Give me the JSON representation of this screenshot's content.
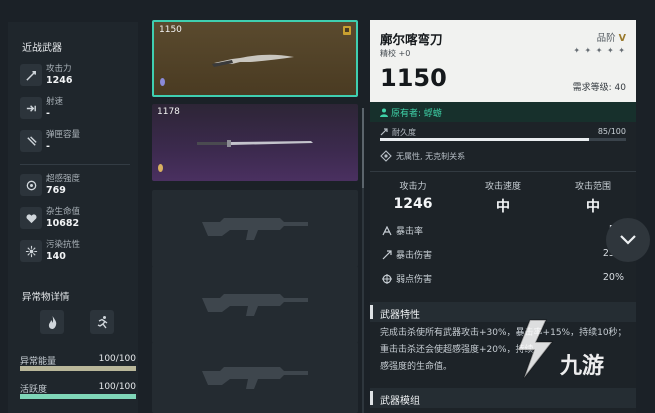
{
  "left_panel": {
    "category": "近战武器",
    "stats": [
      {
        "icon": "attack-icon",
        "label": "攻击力",
        "value": "1246"
      },
      {
        "icon": "fire-rate-icon",
        "label": "射速",
        "value": "-"
      },
      {
        "icon": "magazine-icon",
        "label": "弹匣容量",
        "value": "-"
      },
      {
        "icon": "sense-icon",
        "label": "超感强度",
        "value": "769"
      },
      {
        "icon": "heart-icon",
        "label": "杂生命值",
        "value": "10682"
      },
      {
        "icon": "pollution-icon",
        "label": "污染抗性",
        "value": "140"
      }
    ],
    "anomaly_title": "异常物详情",
    "bars": [
      {
        "label": "异常能量",
        "value": "100/100",
        "fill": 1.0,
        "color": "#b9b79a"
      },
      {
        "label": "活跃度",
        "value": "100/100",
        "fill": 1.0,
        "color": "#7fd6b8"
      }
    ]
  },
  "weapon_list": [
    {
      "power": "1150",
      "selected": true,
      "gem_color": "#8a8ad8"
    },
    {
      "power": "1178",
      "selected": false,
      "gem_color": "#d8b060"
    },
    {
      "power": "",
      "selected": false
    },
    {
      "power": "",
      "selected": false
    },
    {
      "power": "",
      "selected": false
    }
  ],
  "detail": {
    "name": "廓尔喀弯刀",
    "refine": "精校 +0",
    "quality_label": "品阶",
    "quality_value": "V",
    "stars": "✦ ✦ ✦ ✦ ✦",
    "power": "1150",
    "required_level": "需求等级: 40",
    "owner_label": "原有者:",
    "owner_name": "蜉蝣",
    "durability_label": "耐久度",
    "durability_value": "85/100",
    "durability_fill": 0.85,
    "element": "无属性, 无克制关系",
    "main_stats": [
      {
        "label": "攻击力",
        "value": "1246"
      },
      {
        "label": "攻击速度",
        "value": "中"
      },
      {
        "label": "攻击范围",
        "value": "中"
      }
    ],
    "sub_stats": [
      {
        "icon": "crit-rate-icon",
        "label": "暴击率",
        "value": "5%"
      },
      {
        "icon": "crit-damage-icon",
        "label": "暴击伤害",
        "value": "25%"
      },
      {
        "icon": "weakpoint-icon",
        "label": "弱点伤害",
        "value": "20%"
      }
    ],
    "traits_title": "武器特性",
    "traits_text": "完成击杀使所有武器攻击+30%，暴击率+15%，持续10秒；重击击杀还会使超感强度+20%，持续",
    "traits_tail": "感强度的生命值。",
    "mods_title": "武器模组"
  },
  "watermark": "九游",
  "colors": {
    "accent": "#3fcfb0",
    "owner": "#3fd3a8",
    "quality": "#9a7a2c"
  }
}
